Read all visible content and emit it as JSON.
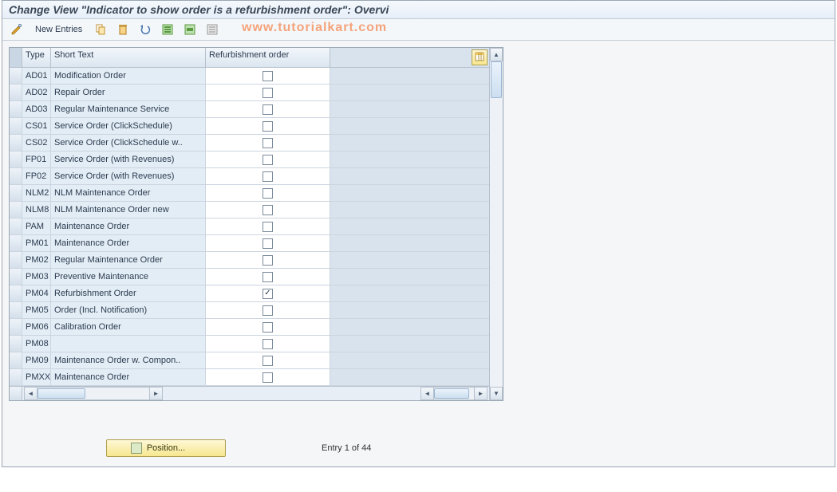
{
  "title": "Change View \"Indicator to show order is a refurbishment order\": Overvi",
  "watermark": "www.tutorialkart.com",
  "toolbar": {
    "new_entries_label": "New Entries"
  },
  "grid": {
    "columns": {
      "type": "Type",
      "short_text": "Short Text",
      "refurbishment": "Refurbishment order"
    },
    "rows": [
      {
        "type": "AD01",
        "text": "Modification Order",
        "refurb": false
      },
      {
        "type": "AD02",
        "text": "Repair Order",
        "refurb": false
      },
      {
        "type": "AD03",
        "text": "Regular Maintenance Service",
        "refurb": false
      },
      {
        "type": "CS01",
        "text": "Service Order (ClickSchedule)",
        "refurb": false
      },
      {
        "type": "CS02",
        "text": "Service Order (ClickSchedule w..",
        "refurb": false
      },
      {
        "type": "FP01",
        "text": "Service Order (with Revenues)",
        "refurb": false
      },
      {
        "type": "FP02",
        "text": "Service Order (with Revenues)",
        "refurb": false
      },
      {
        "type": "NLM2",
        "text": "NLM Maintenance Order",
        "refurb": false
      },
      {
        "type": "NLM8",
        "text": "NLM Maintenance Order new",
        "refurb": false
      },
      {
        "type": "PAM",
        "text": "Maintenance Order",
        "refurb": false
      },
      {
        "type": "PM01",
        "text": "Maintenance Order",
        "refurb": false
      },
      {
        "type": "PM02",
        "text": "Regular Maintenance Order",
        "refurb": false
      },
      {
        "type": "PM03",
        "text": "Preventive Maintenance",
        "refurb": false
      },
      {
        "type": "PM04",
        "text": "Refurbishment Order",
        "refurb": true
      },
      {
        "type": "PM05",
        "text": "Order (Incl. Notification)",
        "refurb": false
      },
      {
        "type": "PM06",
        "text": "Calibration Order",
        "refurb": false
      },
      {
        "type": "PM08",
        "text": "",
        "refurb": false
      },
      {
        "type": "PM09",
        "text": "Maintenance Order w. Compon..",
        "refurb": false
      },
      {
        "type": "PMXX",
        "text": "Maintenance Order",
        "refurb": false
      }
    ]
  },
  "footer": {
    "position_label": "Position...",
    "entry_text": "Entry 1 of 44"
  }
}
